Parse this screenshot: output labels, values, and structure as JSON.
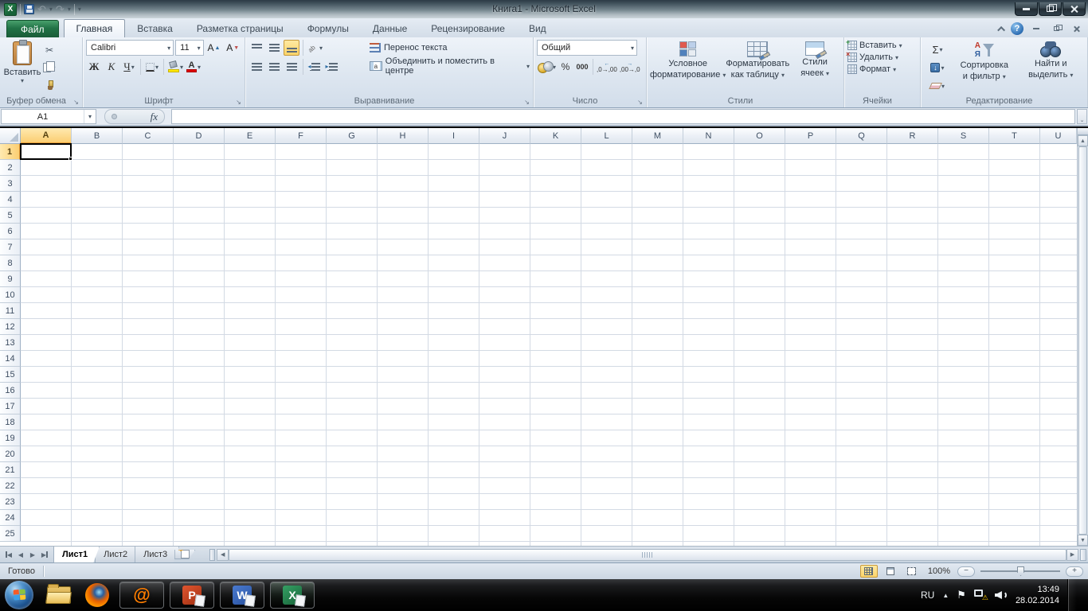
{
  "window": {
    "title": "Книга1  -  Microsoft Excel"
  },
  "tabs": {
    "file": "Файл",
    "active": "Главная",
    "items": [
      "Главная",
      "Вставка",
      "Разметка страницы",
      "Формулы",
      "Данные",
      "Рецензирование",
      "Вид"
    ]
  },
  "ribbon": {
    "clipboard": {
      "paste": "Вставить",
      "label": "Буфер обмена"
    },
    "font": {
      "name": "Calibri",
      "size": "11",
      "bold": "Ж",
      "italic": "К",
      "underline": "Ч",
      "label": "Шрифт"
    },
    "alignment": {
      "wrap": "Перенос текста",
      "merge": "Объединить и поместить в центре",
      "label": "Выравнивание"
    },
    "number": {
      "format": "Общий",
      "percent": "%",
      "thousands": "000",
      "label": "Число"
    },
    "styles": {
      "conditional_line1": "Условное",
      "conditional_line2": "форматирование",
      "table_line1": "Форматировать",
      "table_line2": "как таблицу",
      "cellstyles_line1": "Стили",
      "cellstyles_line2": "ячеек",
      "label": "Стили"
    },
    "cells": {
      "insert": "Вставить",
      "delete": "Удалить",
      "format": "Формат",
      "label": "Ячейки"
    },
    "editing": {
      "autosum": "Σ",
      "sort_line1": "Сортировка",
      "sort_line2": "и фильтр",
      "find_line1": "Найти и",
      "find_line2": "выделить",
      "label": "Редактирование"
    }
  },
  "formula_bar": {
    "name_box": "A1",
    "fx": "fx",
    "value": ""
  },
  "grid": {
    "columns": [
      "A",
      "B",
      "C",
      "D",
      "E",
      "F",
      "G",
      "H",
      "I",
      "J",
      "K",
      "L",
      "M",
      "N",
      "O",
      "P",
      "Q",
      "R",
      "S",
      "T",
      "U"
    ],
    "row_count": 25,
    "selected_cell": "A1",
    "selected_column": "A",
    "selected_row": "1"
  },
  "sheets": {
    "active": "Лист1",
    "tabs": [
      "Лист1",
      "Лист2",
      "Лист3"
    ]
  },
  "status": {
    "ready": "Готово",
    "zoom": "100%"
  },
  "taskbar": {
    "lang": "RU",
    "time": "13:49",
    "date": "28.02.2014"
  },
  "colors": {
    "file_tab_green": "#217346",
    "selection_header": "#fbce72",
    "taskbar_black": "#000000"
  }
}
